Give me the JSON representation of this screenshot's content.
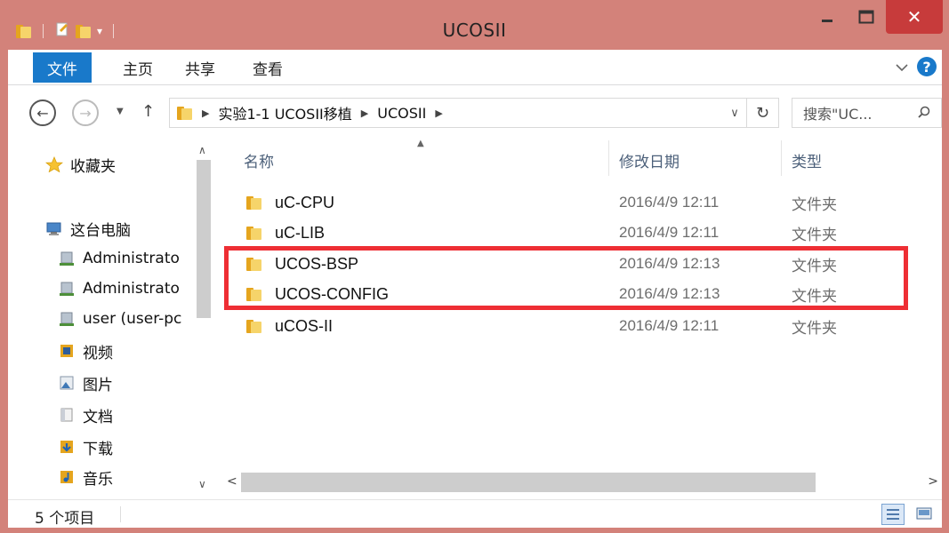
{
  "window": {
    "title": "UCOSII"
  },
  "ribbon": {
    "tabs": [
      {
        "label": "文件"
      },
      {
        "label": "主页"
      },
      {
        "label": "共享"
      },
      {
        "label": "查看"
      }
    ]
  },
  "address": {
    "crumbs": [
      "实验1-1 UCOSII移植",
      "UCOSII"
    ]
  },
  "search": {
    "placeholder": "搜索\"UC..."
  },
  "nav": {
    "items": [
      {
        "label": "收藏夹",
        "icon": "star-icon"
      },
      {
        "label": "这台电脑",
        "icon": "computer-icon"
      },
      {
        "label": "Administrato",
        "icon": "network-drive-icon"
      },
      {
        "label": "Administrato",
        "icon": "network-drive-icon"
      },
      {
        "label": "user (user-pc",
        "icon": "network-drive-icon"
      },
      {
        "label": "视频",
        "icon": "video-folder-icon"
      },
      {
        "label": "图片",
        "icon": "pictures-folder-icon"
      },
      {
        "label": "文档",
        "icon": "documents-folder-icon"
      },
      {
        "label": "下载",
        "icon": "downloads-folder-icon"
      },
      {
        "label": "音乐",
        "icon": "music-folder-icon"
      }
    ]
  },
  "columns": {
    "name": "名称",
    "date": "修改日期",
    "type": "类型"
  },
  "files": [
    {
      "name": "uC-CPU",
      "date": "2016/4/9 12:11",
      "type": "文件夹"
    },
    {
      "name": "uC-LIB",
      "date": "2016/4/9 12:11",
      "type": "文件夹"
    },
    {
      "name": "UCOS-BSP",
      "date": "2016/4/9 12:13",
      "type": "文件夹"
    },
    {
      "name": "UCOS-CONFIG",
      "date": "2016/4/9 12:13",
      "type": "文件夹"
    },
    {
      "name": "uCOS-II",
      "date": "2016/4/9 12:11",
      "type": "文件夹"
    }
  ],
  "status": {
    "count": "5 个项目"
  },
  "colors": {
    "accent": "#1979ca",
    "frame": "#d3827a",
    "close": "#c73b3b",
    "highlight": "#ee2e34"
  }
}
